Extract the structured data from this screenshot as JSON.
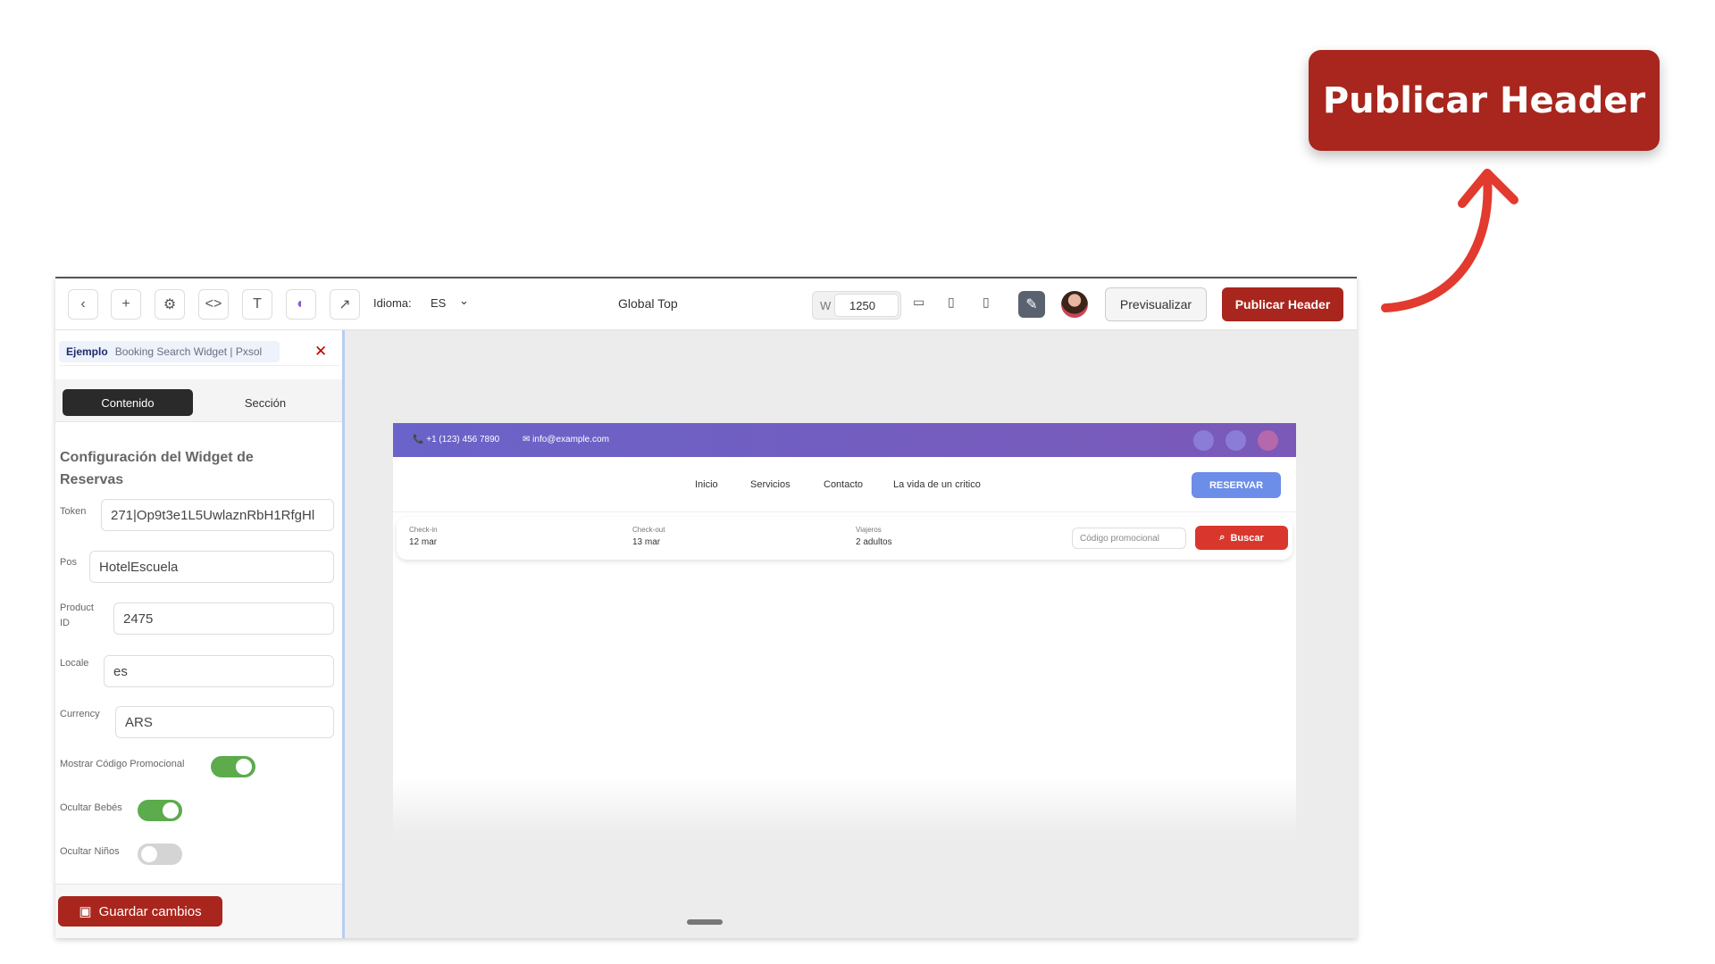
{
  "callout": {
    "label": "Publicar Header"
  },
  "toolbar": {
    "idioma_label": "Idioma:",
    "idioma_value": "ES",
    "page_title": "Global Top",
    "width_label": "W",
    "width_value": "1250",
    "preview_label": "Previsualizar",
    "publish_label": "Publicar Header",
    "icons": [
      "chevron-left-icon",
      "plus-icon",
      "gear-icon",
      "code-icon",
      "text-icon",
      "palette-icon",
      "external-link-icon",
      "chevron-down-icon",
      "desktop-icon",
      "tablet-icon",
      "mobile-icon",
      "edit-icon"
    ]
  },
  "sidebar": {
    "tag_bold": "Ejemplo",
    "tag_text": "Booking Search Widget | Pxsol",
    "tabs": {
      "contenido": "Contenido",
      "seccion": "Sección"
    },
    "section_title": "Configuración del Widget de Reservas",
    "fields": {
      "token": {
        "label": "Token",
        "value": "271|Op9t3e1L5UwlaznRbH1RfgHl"
      },
      "pos": {
        "label": "Pos",
        "value": "HotelEscuela"
      },
      "product": {
        "label": "Product ID",
        "value": "2475"
      },
      "locale": {
        "label": "Locale",
        "value": "es"
      },
      "currency": {
        "label": "Currency",
        "value": "ARS"
      }
    },
    "toggles": {
      "promo": {
        "label": "Mostrar Código Promocional",
        "on": true
      },
      "bebes": {
        "label": "Ocultar Bebés",
        "on": true
      },
      "ninos": {
        "label": "Ocultar Niños",
        "on": false
      }
    },
    "save_label": "Guardar cambios"
  },
  "preview": {
    "phone": "+1 (123) 456 7890",
    "email": "info@example.com",
    "nav": [
      "Inicio",
      "Servicios",
      "Contacto",
      "La vida de un critico"
    ],
    "reservar_label": "RESERVAR",
    "search": {
      "checkin_label": "Check-in",
      "checkin_value": "12 mar",
      "checkout_label": "Check-out",
      "checkout_value": "13 mar",
      "viajeros_label": "Viajeros",
      "viajeros_value": "2 adultos",
      "promo_placeholder": "Código promocional",
      "buscar_label": "Buscar"
    }
  },
  "colors": {
    "brand_red": "#a8261d",
    "accent_purple": "#6a63c9",
    "toggle_green": "#5cab4d",
    "arrow_red": "#e23a2e"
  }
}
